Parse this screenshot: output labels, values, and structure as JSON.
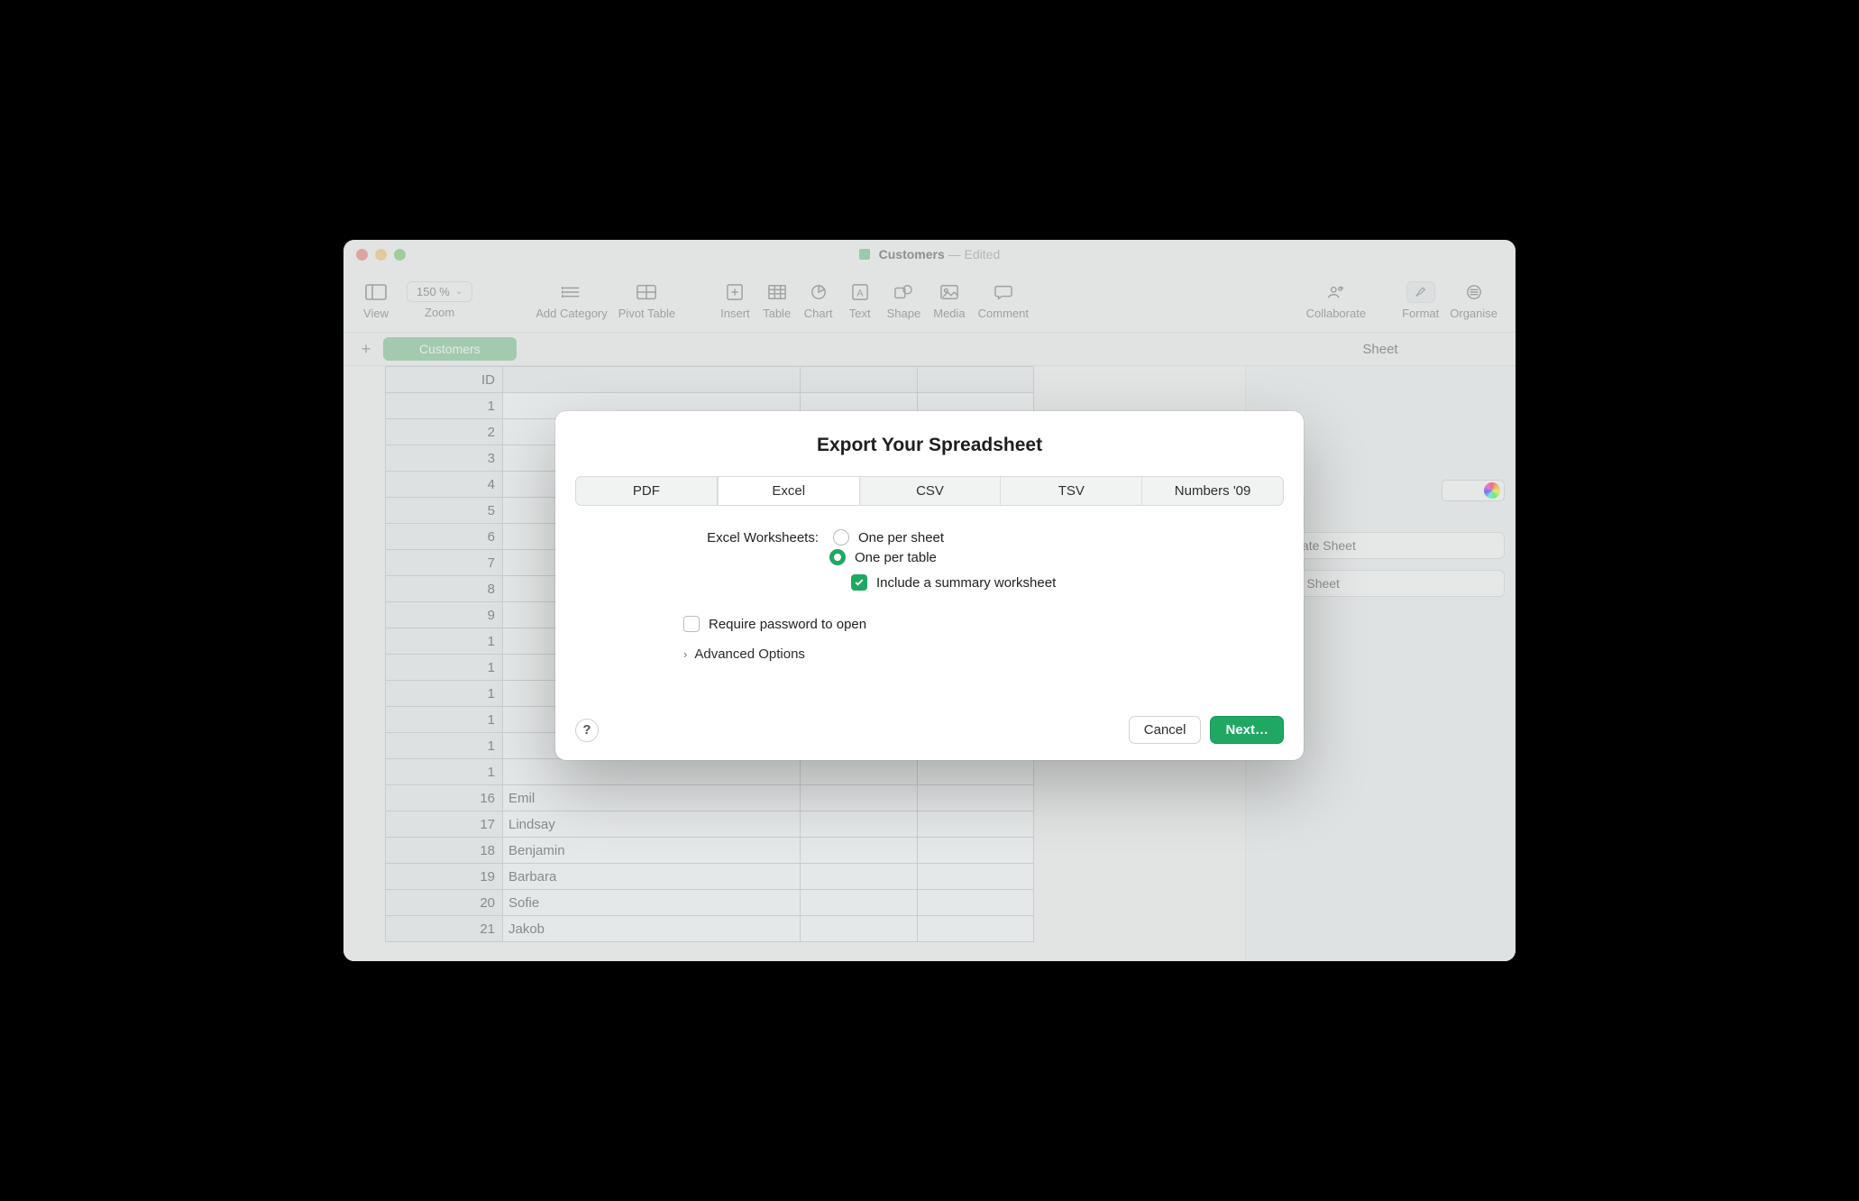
{
  "window": {
    "document_name": "Customers",
    "edited_label": "— Edited"
  },
  "toolbar": {
    "view": {
      "label": "View"
    },
    "zoom": {
      "label": "Zoom",
      "value": "150 %"
    },
    "addcat": {
      "label": "Add Category"
    },
    "pivot": {
      "label": "Pivot Table"
    },
    "insert": {
      "label": "Insert"
    },
    "table": {
      "label": "Table"
    },
    "chart": {
      "label": "Chart"
    },
    "text": {
      "label": "Text"
    },
    "shape": {
      "label": "Shape"
    },
    "media": {
      "label": "Media"
    },
    "comment": {
      "label": "Comment"
    },
    "collaborate": {
      "label": "Collaborate"
    },
    "format": {
      "label": "Format"
    },
    "organise": {
      "label": "Organise"
    }
  },
  "tabs": {
    "sheet_name": "Customers",
    "inspector_title": "Sheet"
  },
  "inspector": {
    "duplicate": "Duplicate Sheet",
    "delete": "Delete Sheet"
  },
  "table": {
    "header": [
      "ID",
      ""
    ],
    "rows": [
      [
        "1",
        ""
      ],
      [
        "2",
        ""
      ],
      [
        "3",
        ""
      ],
      [
        "4",
        ""
      ],
      [
        "5",
        ""
      ],
      [
        "6",
        ""
      ],
      [
        "7",
        ""
      ],
      [
        "8",
        ""
      ],
      [
        "9",
        ""
      ],
      [
        "1",
        ""
      ],
      [
        "1",
        ""
      ],
      [
        "1",
        ""
      ],
      [
        "1",
        ""
      ],
      [
        "1",
        ""
      ],
      [
        "1",
        ""
      ],
      [
        "16",
        "Emil"
      ],
      [
        "17",
        "Lindsay"
      ],
      [
        "18",
        "Benjamin"
      ],
      [
        "19",
        "Barbara"
      ],
      [
        "20",
        "Sofie"
      ],
      [
        "21",
        "Jakob"
      ]
    ]
  },
  "modal": {
    "title": "Export Your Spreadsheet",
    "tabs": [
      "PDF",
      "Excel",
      "CSV",
      "TSV",
      "Numbers '09"
    ],
    "active_tab": 1,
    "worksheets_label": "Excel Worksheets:",
    "radio_sheet": "One per sheet",
    "radio_table": "One per table",
    "include_summary": "Include a summary worksheet",
    "require_password": "Require password to open",
    "advanced": "Advanced Options",
    "cancel": "Cancel",
    "next": "Next…",
    "help": "?"
  }
}
